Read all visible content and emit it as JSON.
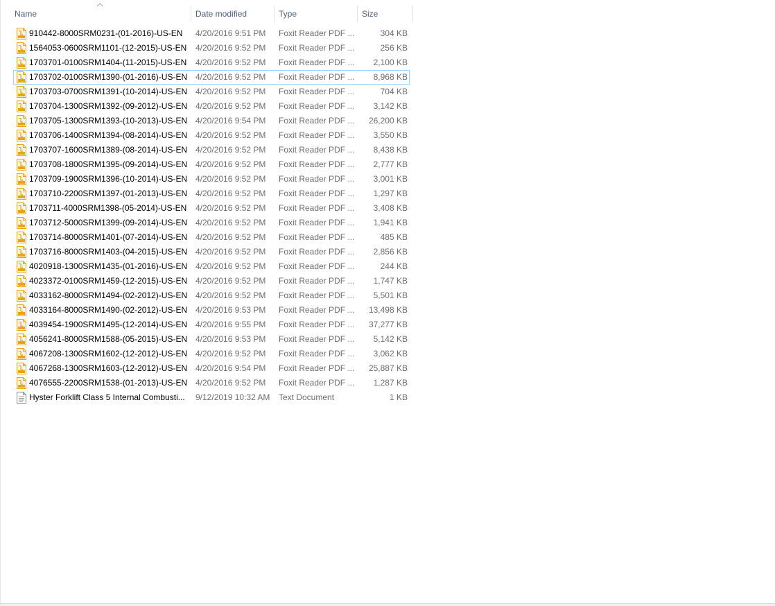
{
  "columns": {
    "name": "Name",
    "date_modified": "Date modified",
    "type": "Type",
    "size": "Size"
  },
  "sort": {
    "column": "name",
    "direction": "ascending"
  },
  "colors": {
    "header_text": "#4c607a",
    "secondary_text": "#6d6d6d",
    "focus_border": "#99d1ff",
    "pdf_icon": "#e8a317"
  },
  "files": [
    {
      "name": "910442-8000SRM0231-(01-2016)-US-EN",
      "date": "4/20/2016 9:51 PM",
      "type": "Foxit Reader PDF ...",
      "size": "304 KB",
      "icon": "pdf-file-icon"
    },
    {
      "name": "1564053-0600SRM1101-(12-2015)-US-EN",
      "date": "4/20/2016 9:52 PM",
      "type": "Foxit Reader PDF ...",
      "size": "256 KB",
      "icon": "pdf-file-icon"
    },
    {
      "name": "1703701-0100SRM1404-(11-2015)-US-EN",
      "date": "4/20/2016 9:52 PM",
      "type": "Foxit Reader PDF ...",
      "size": "2,100 KB",
      "icon": "pdf-file-icon"
    },
    {
      "name": "1703702-0100SRM1390-(01-2016)-US-EN",
      "date": "4/20/2016 9:52 PM",
      "type": "Foxit Reader PDF ...",
      "size": "8,968 KB",
      "icon": "pdf-file-icon",
      "focused": true
    },
    {
      "name": "1703703-0700SRM1391-(10-2014)-US-EN",
      "date": "4/20/2016 9:52 PM",
      "type": "Foxit Reader PDF ...",
      "size": "704 KB",
      "icon": "pdf-file-icon"
    },
    {
      "name": "1703704-1300SRM1392-(09-2012)-US-EN",
      "date": "4/20/2016 9:52 PM",
      "type": "Foxit Reader PDF ...",
      "size": "3,142 KB",
      "icon": "pdf-file-icon"
    },
    {
      "name": "1703705-1300SRM1393-(10-2013)-US-EN",
      "date": "4/20/2016 9:54 PM",
      "type": "Foxit Reader PDF ...",
      "size": "26,200 KB",
      "icon": "pdf-file-icon"
    },
    {
      "name": "1703706-1400SRM1394-(08-2014)-US-EN",
      "date": "4/20/2016 9:52 PM",
      "type": "Foxit Reader PDF ...",
      "size": "3,550 KB",
      "icon": "pdf-file-icon"
    },
    {
      "name": "1703707-1600SRM1389-(08-2014)-US-EN",
      "date": "4/20/2016 9:52 PM",
      "type": "Foxit Reader PDF ...",
      "size": "8,438 KB",
      "icon": "pdf-file-icon"
    },
    {
      "name": "1703708-1800SRM1395-(09-2014)-US-EN",
      "date": "4/20/2016 9:52 PM",
      "type": "Foxit Reader PDF ...",
      "size": "2,777 KB",
      "icon": "pdf-file-icon"
    },
    {
      "name": "1703709-1900SRM1396-(10-2014)-US-EN",
      "date": "4/20/2016 9:52 PM",
      "type": "Foxit Reader PDF ...",
      "size": "3,001 KB",
      "icon": "pdf-file-icon"
    },
    {
      "name": "1703710-2200SRM1397-(01-2013)-US-EN",
      "date": "4/20/2016 9:52 PM",
      "type": "Foxit Reader PDF ...",
      "size": "1,297 KB",
      "icon": "pdf-file-icon"
    },
    {
      "name": "1703711-4000SRM1398-(05-2014)-US-EN",
      "date": "4/20/2016 9:52 PM",
      "type": "Foxit Reader PDF ...",
      "size": "3,408 KB",
      "icon": "pdf-file-icon"
    },
    {
      "name": "1703712-5000SRM1399-(09-2014)-US-EN",
      "date": "4/20/2016 9:52 PM",
      "type": "Foxit Reader PDF ...",
      "size": "1,941 KB",
      "icon": "pdf-file-icon"
    },
    {
      "name": "1703714-8000SRM1401-(07-2014)-US-EN",
      "date": "4/20/2016 9:52 PM",
      "type": "Foxit Reader PDF ...",
      "size": "485 KB",
      "icon": "pdf-file-icon"
    },
    {
      "name": "1703716-8000SRM1403-(04-2015)-US-EN",
      "date": "4/20/2016 9:52 PM",
      "type": "Foxit Reader PDF ...",
      "size": "2,856 KB",
      "icon": "pdf-file-icon"
    },
    {
      "name": "4020918-1300SRM1435-(01-2016)-US-EN",
      "date": "4/20/2016 9:52 PM",
      "type": "Foxit Reader PDF ...",
      "size": "244 KB",
      "icon": "pdf-file-icon"
    },
    {
      "name": "4023372-0100SRM1459-(12-2015)-US-EN",
      "date": "4/20/2016 9:52 PM",
      "type": "Foxit Reader PDF ...",
      "size": "1,747 KB",
      "icon": "pdf-file-icon"
    },
    {
      "name": "4033162-8000SRM1494-(02-2012)-US-EN",
      "date": "4/20/2016 9:52 PM",
      "type": "Foxit Reader PDF ...",
      "size": "5,501 KB",
      "icon": "pdf-file-icon"
    },
    {
      "name": "4033164-8000SRM1490-(02-2012)-US-EN",
      "date": "4/20/2016 9:53 PM",
      "type": "Foxit Reader PDF ...",
      "size": "13,498 KB",
      "icon": "pdf-file-icon"
    },
    {
      "name": "4039454-1900SRM1495-(12-2014)-US-EN",
      "date": "4/20/2016 9:55 PM",
      "type": "Foxit Reader PDF ...",
      "size": "37,277 KB",
      "icon": "pdf-file-icon"
    },
    {
      "name": "4056241-8000SRM1588-(05-2015)-US-EN",
      "date": "4/20/2016 9:53 PM",
      "type": "Foxit Reader PDF ...",
      "size": "5,142 KB",
      "icon": "pdf-file-icon"
    },
    {
      "name": "4067208-1300SRM1602-(12-2012)-US-EN",
      "date": "4/20/2016 9:52 PM",
      "type": "Foxit Reader PDF ...",
      "size": "3,062 KB",
      "icon": "pdf-file-icon"
    },
    {
      "name": "4067268-1300SRM1603-(12-2012)-US-EN",
      "date": "4/20/2016 9:54 PM",
      "type": "Foxit Reader PDF ...",
      "size": "25,887 KB",
      "icon": "pdf-file-icon"
    },
    {
      "name": "4076555-2200SRM1538-(01-2013)-US-EN",
      "date": "4/20/2016 9:52 PM",
      "type": "Foxit Reader PDF ...",
      "size": "1,287 KB",
      "icon": "pdf-file-icon"
    },
    {
      "name": "Hyster Forklift Class 5 Internal Combusti...",
      "date": "9/12/2019 10:32 AM",
      "type": "Text Document",
      "size": "1 KB",
      "icon": "text-file-icon"
    }
  ]
}
